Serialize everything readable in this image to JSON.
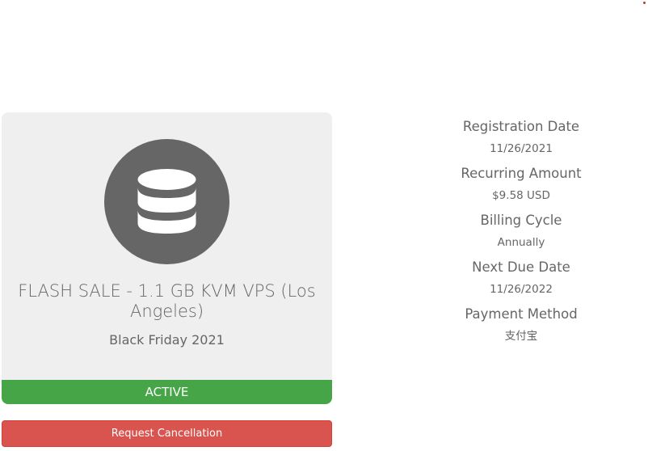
{
  "product": {
    "icon": "database-icon",
    "name": "FLASH SALE - 1.1 GB KVM VPS (Los Angeles)",
    "group": "Black Friday 2021",
    "status": "ACTIVE"
  },
  "actions": {
    "cancel_label": "Request Cancellation"
  },
  "details": [
    {
      "label": "Registration Date",
      "value": "11/26/2021"
    },
    {
      "label": "Recurring Amount",
      "value": "$9.58 USD"
    },
    {
      "label": "Billing Cycle",
      "value": "Annually"
    },
    {
      "label": "Next Due Date",
      "value": "11/26/2022"
    },
    {
      "label": "Payment Method",
      "value": "支付宝"
    }
  ],
  "colors": {
    "status_active": "#46a546",
    "danger": "#d9534f",
    "card_background": "#efefef",
    "icon_circle": "#666666"
  }
}
